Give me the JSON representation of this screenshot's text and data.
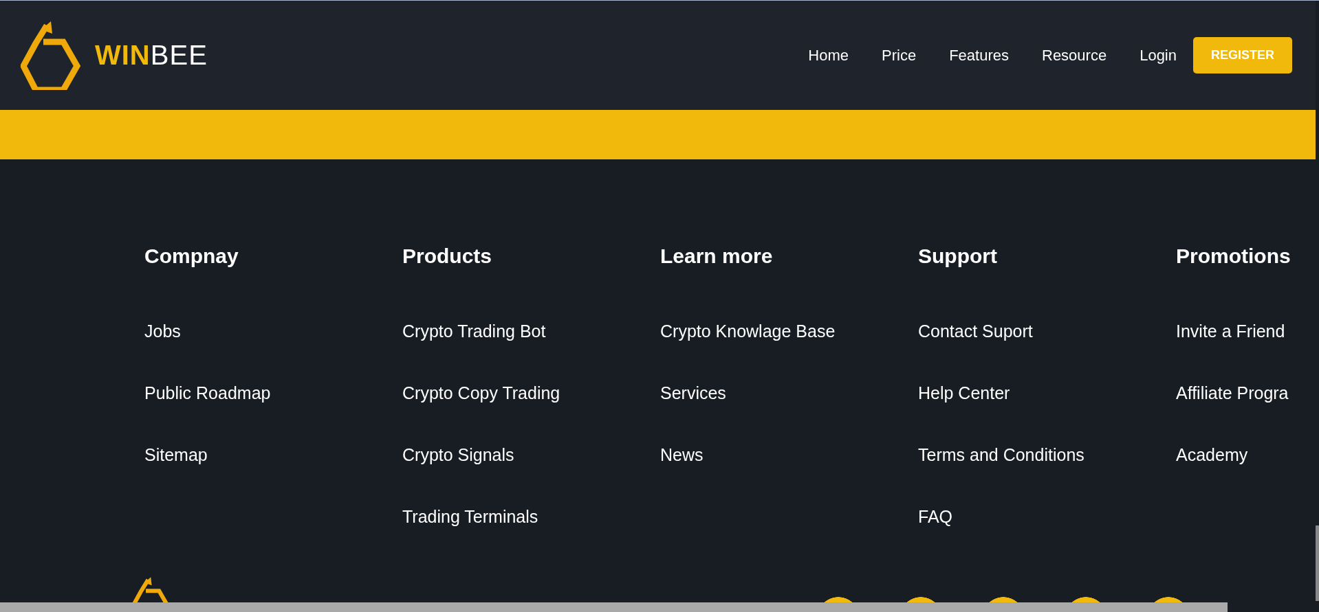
{
  "header": {
    "logo": {
      "highlight": "WIN",
      "rest": "BEE"
    },
    "nav": [
      {
        "label": "Home"
      },
      {
        "label": "Price"
      },
      {
        "label": "Features"
      },
      {
        "label": "Resource"
      },
      {
        "label": "Login"
      }
    ],
    "register_button": "REGISTER"
  },
  "footer": {
    "columns": [
      {
        "heading": "Compnay",
        "links": [
          "Jobs",
          "Public Roadmap",
          "Sitemap"
        ]
      },
      {
        "heading": "Products",
        "links": [
          "Crypto Trading Bot",
          "Crypto Copy Trading",
          "Crypto Signals",
          "Trading Terminals"
        ]
      },
      {
        "heading": "Learn more",
        "links": [
          "Crypto Knowlage Base",
          "Services",
          "News"
        ]
      },
      {
        "heading": "Support",
        "links": [
          "Contact Suport",
          "Help Center",
          "Terms and Conditions",
          "FAQ"
        ]
      },
      {
        "heading": "Promotions",
        "links": [
          "Invite a Friend",
          "Affiliate Progra",
          "Academy"
        ]
      }
    ]
  }
}
